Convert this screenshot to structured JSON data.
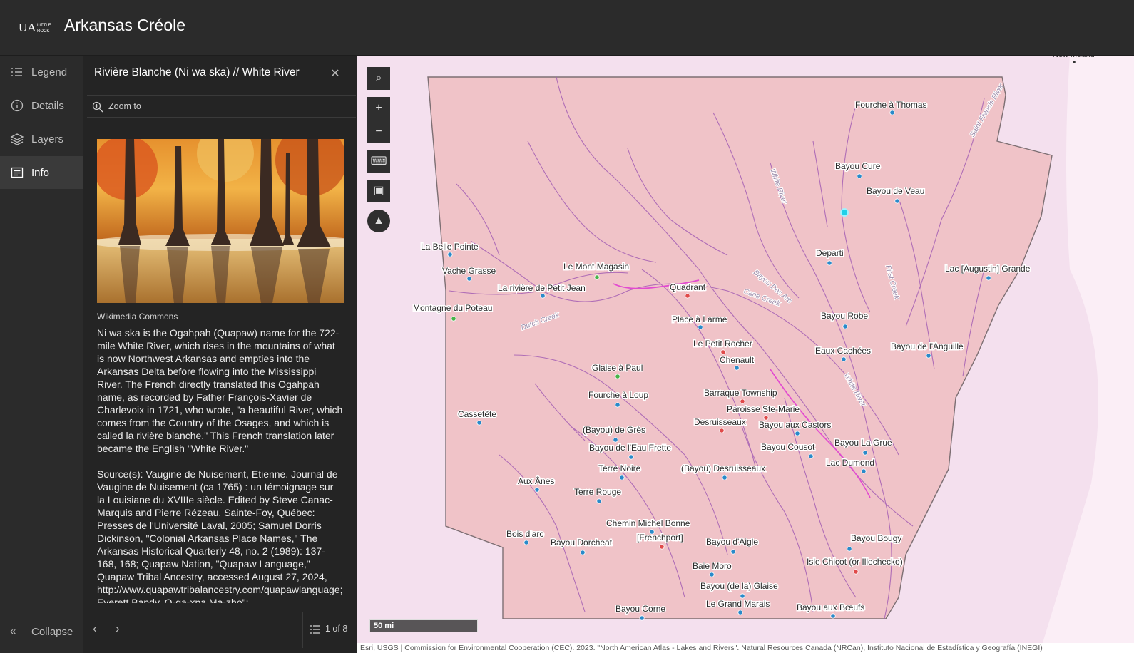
{
  "header": {
    "logo_text": "UALR",
    "app_title": "Arkansas Créole"
  },
  "rail": {
    "items": [
      {
        "label": "Legend",
        "icon": "legend-icon"
      },
      {
        "label": "Details",
        "icon": "info-circle-icon"
      },
      {
        "label": "Layers",
        "icon": "layers-icon"
      },
      {
        "label": "Info",
        "icon": "feature-info-icon",
        "active": true
      }
    ],
    "collapse_label": "Collapse"
  },
  "panel": {
    "title": "Rivière Blanche (Ni wa ska) // White River",
    "zoom_label": "Zoom to",
    "image_caption": "Wikimedia Commons",
    "description": "Ni wa ska is the Ogahpah (Quapaw) name for the 722-mile White River, which rises in the mountains of what is now Northwest Arkansas and empties into the Arkansas Delta before flowing into the Mississippi River. The French directly translated this Ogahpah name, as recorded by Father François-Xavier de Charlevoix in 1721, who wrote, \"a beautiful River, which comes from the Country of the Osages, and which is called la rivière blanche.\" This French translation later became the English \"White River.\"",
    "sources": "Source(s): Vaugine de Nuisement, Etienne. Journal de Vaugine de Nuisement (ca 1765) : un témoignage sur la Louisiane du XVIIIe siècle. Edited by Steve Canac-Marquis and Pierre Rézeau. Sainte-Foy, Québec: Presses de l'Université Laval, 2005; Samuel Dorris Dickinson, \"Colonial Arkansas Place Names,\" The Arkansas Historical Quarterly 48, no. 2 (1989): 137-168, 168; Quapaw Nation, \"Quapaw Language,\" Quapaw Tribal Ancestry, accessed August 27, 2024, http://www.quapawtribalancestry.com/quapawlanguage; Everett Bandy, O-ga-xpa Ma-zho\":",
    "pager": "1 of 8"
  },
  "map": {
    "colors": {
      "state_fill": "#f0c3c8",
      "outside": "#f3dcec",
      "rivers": "#a45fb4",
      "blue_point": "#2a8ac9",
      "green_point": "#48b34a",
      "red_point": "#e04a4a"
    },
    "scale_label": "50 mi",
    "attribution": "Esri, USGS | Commission for Environmental Cooperation (CEC). 2023. \"North American Atlas - Lakes and Rivers\". Natural Resources Canada (NRCan), Instituto Nacional de Estadística y Geografía (INEGI)",
    "corner_label": "New Madrid",
    "river_labels": [
      "White River",
      "Saint Francis River",
      "Bayou Des Arc",
      "Cane Creek",
      "First Creek",
      "Dutch Creek",
      "White River"
    ],
    "places": [
      {
        "name": "Fourche à Thomas",
        "c": "blue"
      },
      {
        "name": "Bayou Cure",
        "c": "blue"
      },
      {
        "name": "Bayou de Veau",
        "c": "blue"
      },
      {
        "name": "La Belle Pointe",
        "c": "blue"
      },
      {
        "name": "Vache Grasse",
        "c": "blue"
      },
      {
        "name": "Le Mont Magasin",
        "c": "green"
      },
      {
        "name": "La rivière de Petit Jean",
        "c": "blue"
      },
      {
        "name": "Quadrant",
        "c": "red"
      },
      {
        "name": "Departi",
        "c": "blue"
      },
      {
        "name": "Lac [Augustin] Grande",
        "c": "blue"
      },
      {
        "name": "Montagne du Poteau",
        "c": "green"
      },
      {
        "name": "Place à Larme",
        "c": "blue"
      },
      {
        "name": "Bayou Robe",
        "c": "blue"
      },
      {
        "name": "Le Petit Rocher",
        "c": "red"
      },
      {
        "name": "Eaux Cachées",
        "c": "blue"
      },
      {
        "name": "Bayou de l'Anguille",
        "c": "blue"
      },
      {
        "name": "Chenault",
        "c": "blue"
      },
      {
        "name": "Glaise à Paul",
        "c": "green"
      },
      {
        "name": "Barraque Township",
        "c": "red"
      },
      {
        "name": "Fourche à Loup",
        "c": "blue"
      },
      {
        "name": "Cassetête",
        "c": "blue"
      },
      {
        "name": "Paroisse Ste-Marie",
        "c": "red"
      },
      {
        "name": "Desruisseaux",
        "c": "red"
      },
      {
        "name": "Bayou aux Castors",
        "c": "blue"
      },
      {
        "name": "(Bayou) de Grès",
        "c": "blue"
      },
      {
        "name": "Bayou La Grue",
        "c": "blue"
      },
      {
        "name": "Bayou de l'Eau Frette",
        "c": "blue"
      },
      {
        "name": "Bayou Cousot",
        "c": "blue"
      },
      {
        "name": "Lac Dumond",
        "c": "blue"
      },
      {
        "name": "Terre Noire",
        "c": "blue"
      },
      {
        "name": "(Bayou) Desruisseaux",
        "c": "blue"
      },
      {
        "name": "Aux Ânes",
        "c": "blue"
      },
      {
        "name": "Terre Rouge",
        "c": "blue"
      },
      {
        "name": "Chemin Michel Bonne",
        "c": "blue"
      },
      {
        "name": "[Frenchport]",
        "c": "red"
      },
      {
        "name": "Bois d'arc",
        "c": "blue"
      },
      {
        "name": "Bayou Dorcheat",
        "c": "blue"
      },
      {
        "name": "Bayou d'Aigle",
        "c": "blue"
      },
      {
        "name": "Bayou Bougy",
        "c": "blue"
      },
      {
        "name": "Isle Chicot (or Illechecko)",
        "c": "red"
      },
      {
        "name": "Baie Moro",
        "c": "blue"
      },
      {
        "name": "Bayou (de la) Glaise",
        "c": "blue"
      },
      {
        "name": "Le Grand Marais",
        "c": "blue"
      },
      {
        "name": "Bayou Corne",
        "c": "blue"
      },
      {
        "name": "Bayou aux Bœufs",
        "c": "blue"
      }
    ]
  }
}
